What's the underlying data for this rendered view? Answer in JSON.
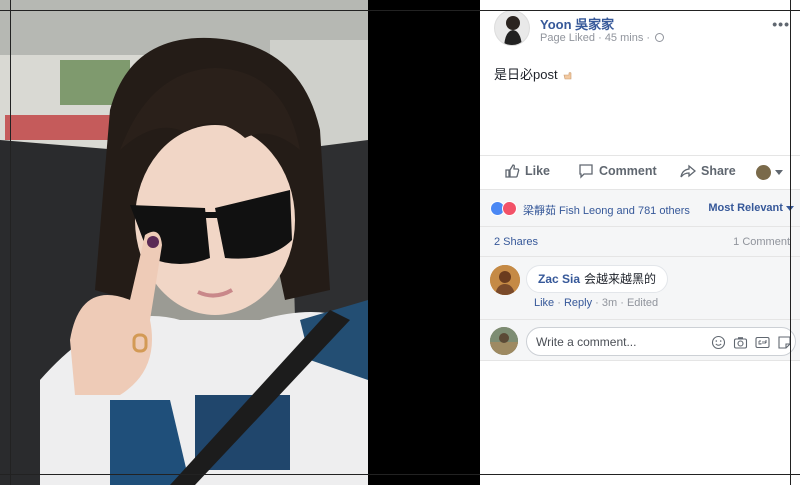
{
  "post": {
    "author": "Yoon 吳家家",
    "meta": "Page Liked · 45 mins ·",
    "text": "是日必post",
    "more_icon": "more-options-icon"
  },
  "actions": {
    "like": "Like",
    "comment": "Comment",
    "share": "Share"
  },
  "reactions": {
    "names": "梁靜茹 Fish Leong and 781 others",
    "sort": "Most Relevant"
  },
  "counts": {
    "shares": "2 Shares",
    "comments": "1 Comment"
  },
  "comment": {
    "name": "Zac Sia",
    "text": "会越来越黑的",
    "like": "Like",
    "reply": "Reply",
    "time": "3m",
    "edited": "Edited",
    "sep1": " · ",
    "sep2": " · ",
    "sep3": " · "
  },
  "composer": {
    "placeholder": "Write a comment..."
  },
  "colors": {
    "link": "#365899",
    "muted": "#90949c",
    "like_reaction": "#4b88f4",
    "love_reaction": "#f25268"
  }
}
